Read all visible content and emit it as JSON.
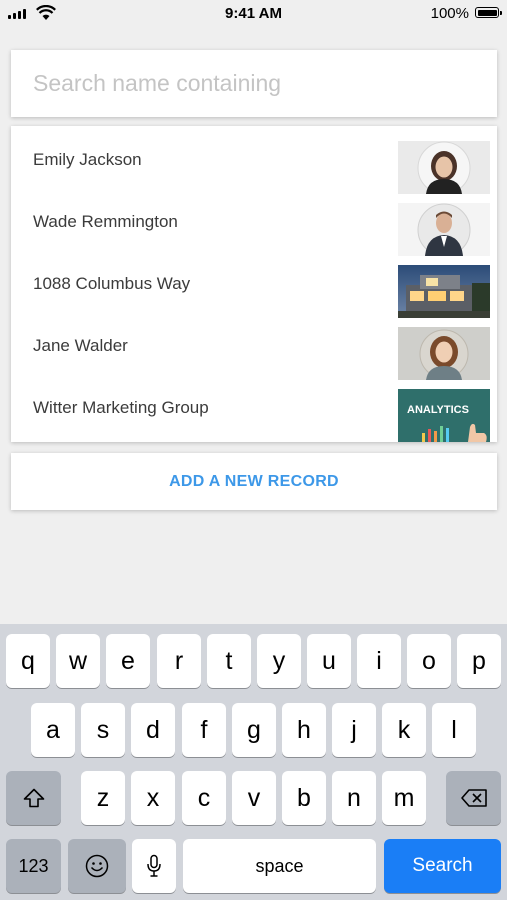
{
  "status_bar": {
    "time": "9:41 AM",
    "battery": "100%"
  },
  "search": {
    "placeholder": "Search name containing",
    "value": ""
  },
  "records": [
    {
      "label": "Emily Jackson",
      "thumb": "woman-portrait-icon"
    },
    {
      "label": "Wade Remmington",
      "thumb": "man-portrait-icon"
    },
    {
      "label": "1088 Columbus Way",
      "thumb": "house-photo-icon"
    },
    {
      "label": "Jane Walder",
      "thumb": "woman-portrait-icon"
    },
    {
      "label": "Witter Marketing Group",
      "thumb": "analytics-chalkboard-icon"
    }
  ],
  "thumb_text": {
    "analytics": "ANALYTICS"
  },
  "add_record": {
    "label": "ADD A NEW RECORD"
  },
  "keyboard": {
    "row1": [
      "q",
      "w",
      "e",
      "r",
      "t",
      "y",
      "u",
      "i",
      "o",
      "p"
    ],
    "row2": [
      "a",
      "s",
      "d",
      "f",
      "g",
      "h",
      "j",
      "k",
      "l"
    ],
    "row3": [
      "z",
      "x",
      "c",
      "v",
      "b",
      "n",
      "m"
    ],
    "numbers": "123",
    "space": "space",
    "search": "Search"
  },
  "colors": {
    "accent": "#3d98e8",
    "search_key": "#1a7ef6",
    "keyboard_bg": "#d2d5db"
  }
}
